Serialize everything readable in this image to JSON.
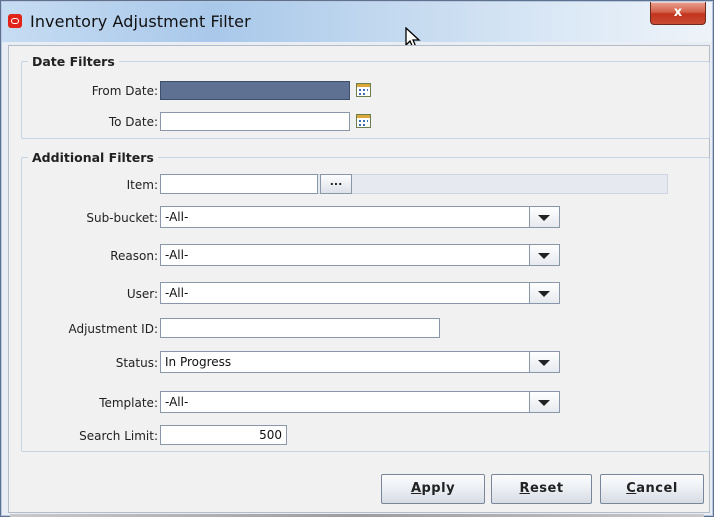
{
  "window": {
    "title": "Inventory Adjustment Filter",
    "close_glyph": "x"
  },
  "date_filters": {
    "legend": "Date Filters",
    "from_label": "From Date:",
    "from_value": "",
    "to_label": "To Date:",
    "to_value": ""
  },
  "additional_filters": {
    "legend": "Additional Filters",
    "item_label": "Item:",
    "item_value": "",
    "item_button": "...",
    "sub_bucket_label": "Sub-bucket:",
    "sub_bucket_value": "-All-",
    "reason_label": "Reason:",
    "reason_value": "-All-",
    "user_label": "User:",
    "user_value": "-All-",
    "adjustment_id_label": "Adjustment ID:",
    "adjustment_id_value": "",
    "status_label": "Status:",
    "status_value": "In Progress",
    "template_label": "Template:",
    "template_value": "-All-",
    "search_limit_label": "Search Limit:",
    "search_limit_value": "500"
  },
  "buttons": {
    "apply_first": "A",
    "apply_rest": "pply",
    "reset_first": "R",
    "reset_rest": "eset",
    "cancel_first": "C",
    "cancel_rest": "ancel"
  },
  "colors": {
    "selected_field": "#5f7193",
    "close_button": "#c2331c",
    "app_icon": "#e2231a"
  },
  "icons": [
    "oracle-app-icon",
    "close-icon",
    "calendar-icon",
    "ellipsis-icon",
    "dropdown-arrow-icon",
    "mouse-cursor-icon"
  ]
}
